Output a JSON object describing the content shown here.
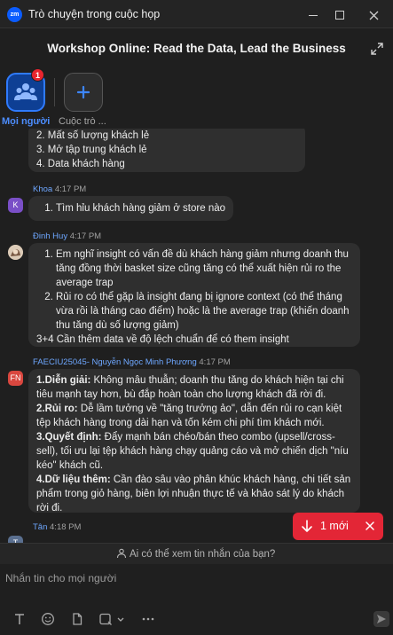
{
  "window": {
    "logo": "zm",
    "title": "Trò chuyện trong cuộc họp"
  },
  "meeting": {
    "title": "Workshop Online: Read the Data, Lead the Business"
  },
  "tabs": {
    "everyone": {
      "label": "Mọi người",
      "badge": "1",
      "icon": "people-icon"
    },
    "chat": {
      "label": "Cuộc trò ...",
      "icon": "plus-icon"
    }
  },
  "messages": [
    {
      "partial": true,
      "items": [
        "2. Mất số lượng khách lẻ",
        "3. Mở tập trung khách lẻ",
        "4. Data khách hàng"
      ]
    },
    {
      "sender": "Khoa",
      "time": "4:17 PM",
      "avatar": "K",
      "items": [
        "Tìm hỉu khách hàng giảm ở store nào"
      ]
    },
    {
      "sender": "Đinh Huy",
      "time": "4:17 PM",
      "items": [
        "Em nghĩ insight có vấn đề dù khách hàng giảm nhưng doanh thu tăng đồng thời basket size cũng tăng có thể xuất hiện rủi ro the average trap",
        "Rủi ro có thể gặp là insight đang bị ignore context (có thể tháng vừa rồi là tháng cao điểm) hoặc là the average trap (khiến doanh thu tăng dù số lượng giảm)"
      ],
      "extra": "3+4 Cần thêm data về độ lệch chuẩn để có them insight"
    },
    {
      "sender": "FAECIU25045- Nguyễn Ngọc Minh Phương",
      "time": "4:17 PM",
      "avatar": "FN",
      "paras": [
        {
          "lead": "1.Diễn giải:",
          "text": " Không mâu thuẫn; doanh thu tăng do khách hiện tại chi tiêu mạnh tay hơn, bù đắp hoàn toàn cho lượng khách đã rời đi."
        },
        {
          "lead": "2.Rủi ro:",
          "text": " Dễ lầm tưởng về \"tăng trưởng ảo\", dẫn đến rủi ro cạn kiệt tệp khách hàng trong dài hạn và tốn kém chi phí tìm khách mới."
        },
        {
          "lead": "3.Quyết định:",
          "text": " Đẩy mạnh bán chéo/bán theo combo (upsell/cross-sell), tối ưu lại tệp khách hàng chạy quảng cáo và mở chiến dịch \"níu kéo\" khách cũ."
        },
        {
          "lead": "4.Dữ liệu thêm:",
          "text": " Cần đào sâu vào phân khúc khách hàng, chi tiết sản phẩm trong giỏ hàng, biên lợi nhuận thực tế và khảo sát lý do khách rời đi."
        }
      ]
    },
    {
      "sender": "Tân",
      "time": "4:18 PM",
      "avatar": "T"
    }
  ],
  "new_toast": {
    "label": "1 mới"
  },
  "seen_bar": {
    "label": "Ai có thể xem tin nhắn của bạn?"
  },
  "compose": {
    "placeholder": "Nhắn tin cho mọi người"
  },
  "colors": {
    "accent": "#0b5cff",
    "toast": "#e32636",
    "name": "#6ea7ff"
  }
}
